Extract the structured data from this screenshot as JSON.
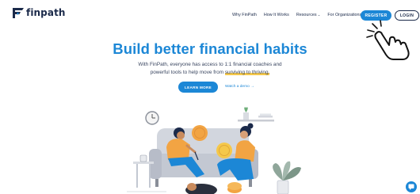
{
  "header": {
    "logo_text": "finpath",
    "nav": [
      {
        "label": "Why FinPath"
      },
      {
        "label": "How It Works"
      },
      {
        "label": "Resources"
      },
      {
        "label": "For Organizations"
      }
    ],
    "register_label": "REGISTER",
    "login_label": "LOGIN"
  },
  "hero": {
    "headline": "Build better financial habits",
    "sub_line1": "With FinPath, everyone has access to 1:1 financial coaches and",
    "sub_line2_pre": "powerful tools to help move from ",
    "sub_line2_highlight": "surviving to thriving.",
    "learn_more_label": "LEARN MORE",
    "watch_demo_label": "Watch a demo →"
  },
  "colors": {
    "brand_blue": "#1c87d6",
    "navy": "#1b2a4a",
    "highlight_yellow": "#f5c84a",
    "coin_orange": "#f2a443"
  },
  "icons": [
    "finpath-logo-icon",
    "chevron-down-icon",
    "pointing-hand-icon",
    "clock-icon",
    "chat-icon"
  ]
}
